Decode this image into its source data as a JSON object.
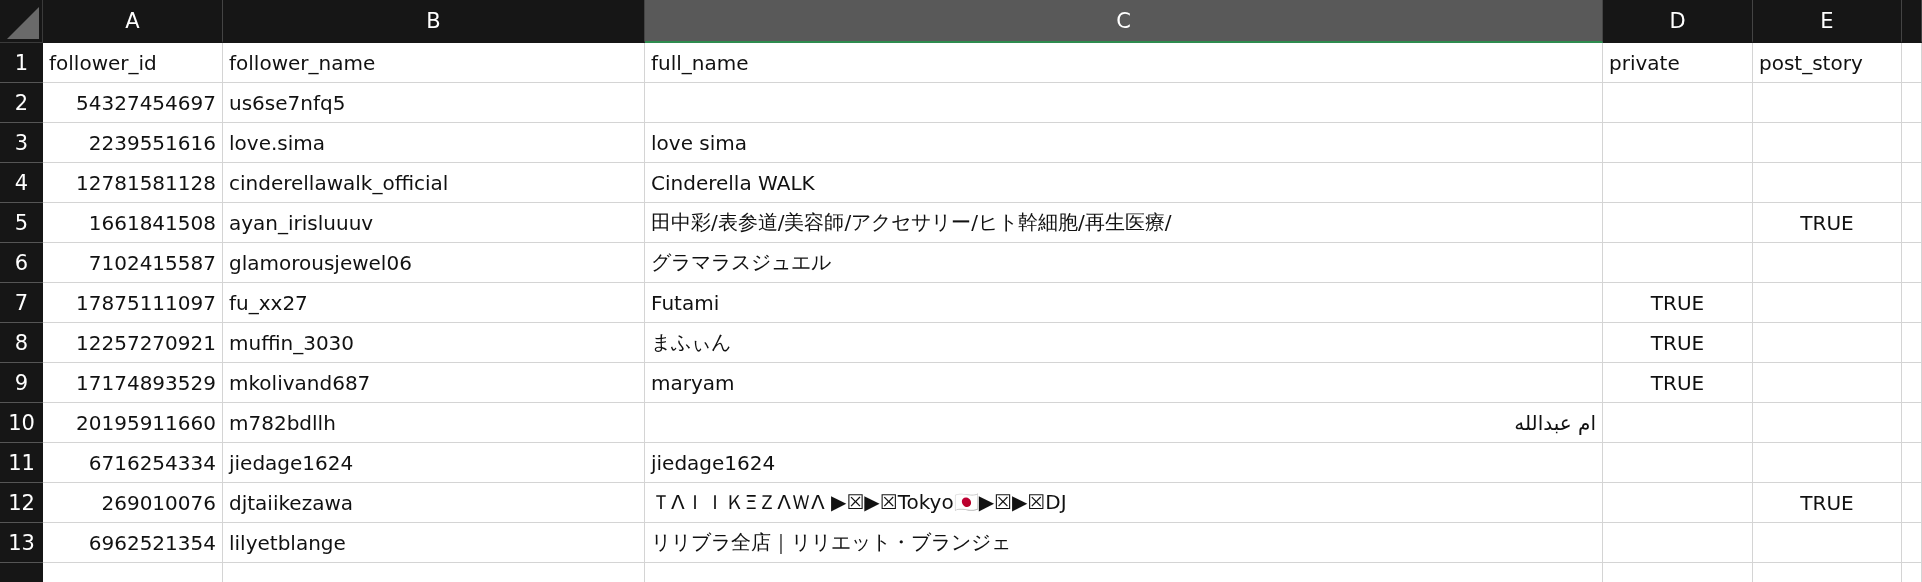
{
  "columns": [
    {
      "label": "A",
      "selected": false
    },
    {
      "label": "B",
      "selected": false
    },
    {
      "label": "C",
      "selected": true
    },
    {
      "label": "D",
      "selected": false
    },
    {
      "label": "E",
      "selected": false
    }
  ],
  "rows": [
    {
      "number": "1",
      "cells": [
        {
          "text": "follower_id",
          "kind": "text"
        },
        {
          "text": "follower_name",
          "kind": "text"
        },
        {
          "text": "full_name",
          "kind": "text"
        },
        {
          "text": "private",
          "kind": "text"
        },
        {
          "text": "post_story",
          "kind": "text"
        }
      ]
    },
    {
      "number": "2",
      "cells": [
        {
          "text": "54327454697",
          "kind": "number"
        },
        {
          "text": "us6se7nfq5",
          "kind": "text"
        },
        null,
        null,
        null
      ]
    },
    {
      "number": "3",
      "cells": [
        {
          "text": "2239551616",
          "kind": "number"
        },
        {
          "text": "love.sima",
          "kind": "text"
        },
        {
          "text": "love sima",
          "kind": "text"
        },
        null,
        null
      ]
    },
    {
      "number": "4",
      "cells": [
        {
          "text": "12781581128",
          "kind": "number"
        },
        {
          "text": "cinderellawalk_official",
          "kind": "text"
        },
        {
          "text": "Cinderella WALK",
          "kind": "text"
        },
        null,
        null
      ]
    },
    {
      "number": "5",
      "cells": [
        {
          "text": "1661841508",
          "kind": "number"
        },
        {
          "text": "ayan_irisluuuv",
          "kind": "text"
        },
        {
          "text": "田中彩/表参道/美容師/アクセサリー/ヒト幹細胞/再生医療/",
          "kind": "text"
        },
        null,
        {
          "text": "TRUE",
          "kind": "boolean"
        }
      ]
    },
    {
      "number": "6",
      "cells": [
        {
          "text": "7102415587",
          "kind": "number"
        },
        {
          "text": "glamorousjewel06",
          "kind": "text"
        },
        {
          "text": "グラマラスジュエル",
          "kind": "text"
        },
        null,
        null
      ]
    },
    {
      "number": "7",
      "cells": [
        {
          "text": "17875111097",
          "kind": "number"
        },
        {
          "text": "fu_xx27",
          "kind": "text"
        },
        {
          "text": "Futami",
          "kind": "text"
        },
        {
          "text": "TRUE",
          "kind": "boolean"
        },
        null
      ]
    },
    {
      "number": "8",
      "cells": [
        {
          "text": "12257270921",
          "kind": "number"
        },
        {
          "text": "muffin_3030",
          "kind": "text"
        },
        {
          "text": "まふぃん",
          "kind": "text"
        },
        {
          "text": "TRUE",
          "kind": "boolean"
        },
        null
      ]
    },
    {
      "number": "9",
      "cells": [
        {
          "text": "17174893529",
          "kind": "number"
        },
        {
          "text": "mkolivand687",
          "kind": "text"
        },
        {
          "text": "maryam",
          "kind": "text"
        },
        {
          "text": "TRUE",
          "kind": "boolean"
        },
        null
      ]
    },
    {
      "number": "10",
      "cells": [
        {
          "text": "20195911660",
          "kind": "number"
        },
        {
          "text": "m782bdllh",
          "kind": "text"
        },
        {
          "text": "ام عبدالله",
          "kind": "text"
        },
        null,
        null
      ]
    },
    {
      "number": "11",
      "cells": [
        {
          "text": "6716254334",
          "kind": "number"
        },
        {
          "text": "jiedage1624",
          "kind": "text"
        },
        {
          "text": "jiedage1624",
          "kind": "text"
        },
        null,
        null
      ]
    },
    {
      "number": "12",
      "cells": [
        {
          "text": "269010076",
          "kind": "number"
        },
        {
          "text": "djtaiikezawa",
          "kind": "text"
        },
        {
          "text": "ＴΛＩＩＫΞＺΛＷΛ ▶☒▶☒Tokyo🇯🇵▶☒▶☒DJ",
          "kind": "text"
        },
        null,
        {
          "text": "TRUE",
          "kind": "boolean"
        }
      ]
    },
    {
      "number": "13",
      "cells": [
        {
          "text": "6962521354",
          "kind": "number"
        },
        {
          "text": "lilyetblange",
          "kind": "text"
        },
        {
          "text": "リリブラ全店｜リリエット・ブランジェ",
          "kind": "text"
        },
        null,
        null
      ]
    }
  ]
}
